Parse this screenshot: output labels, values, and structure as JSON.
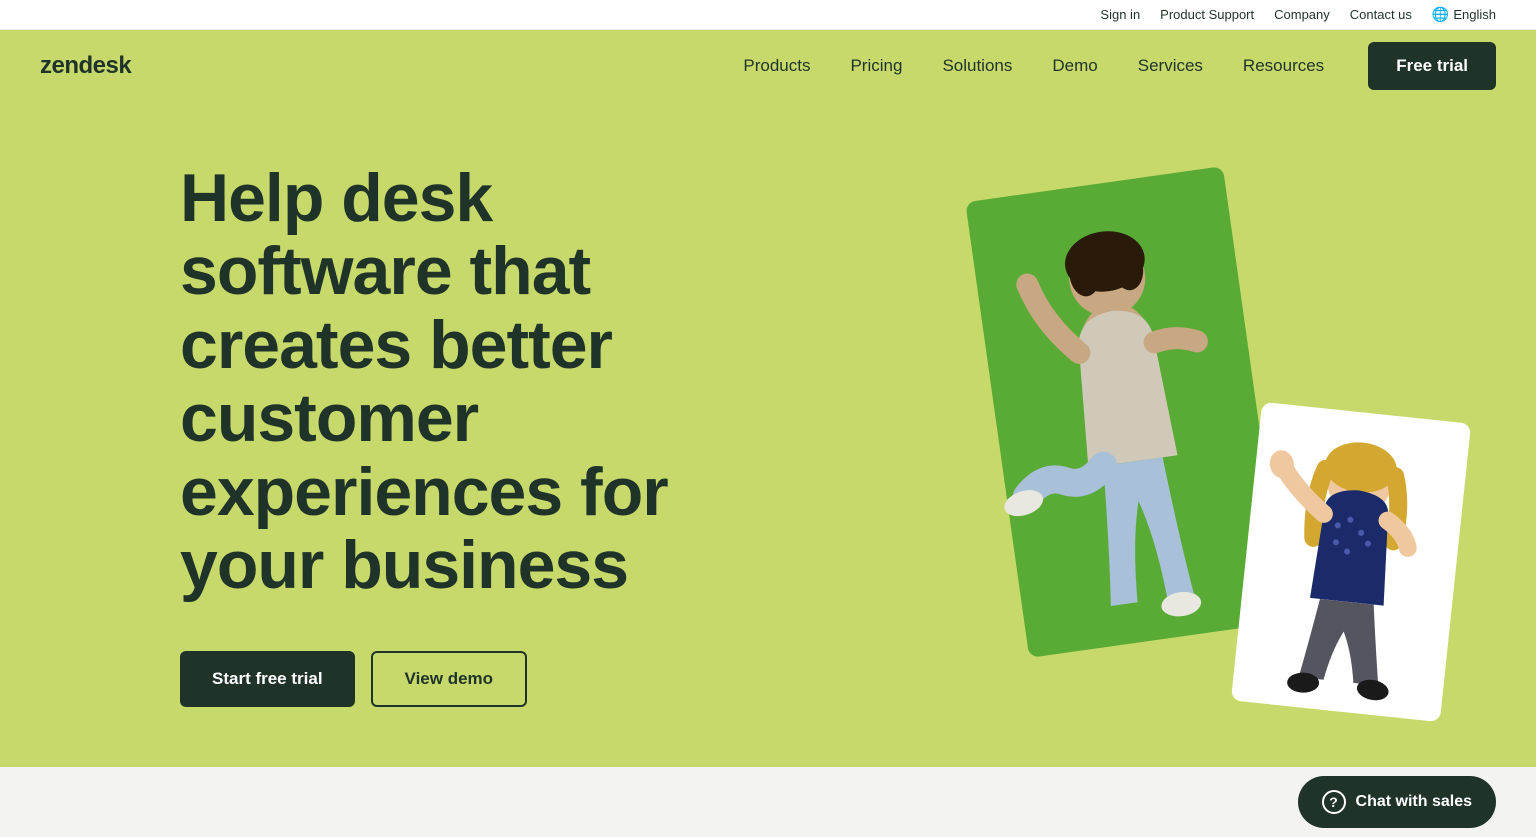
{
  "utility_bar": {
    "sign_in": "Sign in",
    "product_support": "Product Support",
    "company": "Company",
    "contact_us": "Contact us",
    "language": "English",
    "globe_icon": "🌐"
  },
  "nav": {
    "logo": "zendesk",
    "links": [
      {
        "id": "products",
        "label": "Products"
      },
      {
        "id": "pricing",
        "label": "Pricing"
      },
      {
        "id": "solutions",
        "label": "Solutions"
      },
      {
        "id": "demo",
        "label": "Demo"
      },
      {
        "id": "services",
        "label": "Services"
      },
      {
        "id": "resources",
        "label": "Resources"
      }
    ],
    "cta_label": "Free trial"
  },
  "hero": {
    "headline": "Help desk software that creates better customer experiences for your business",
    "btn_start_trial": "Start free trial",
    "btn_view_demo": "View demo"
  },
  "bottom_bar": {
    "chat_label": "Chat with sales",
    "chat_icon": "?"
  },
  "colors": {
    "bg_green": "#c8d96b",
    "dark_green": "#1f3329",
    "medium_green": "#6aad3e"
  }
}
